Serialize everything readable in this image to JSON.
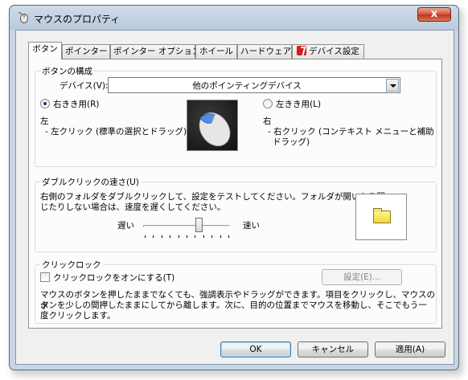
{
  "window": {
    "title": "マウスのプロパティ",
    "close_label": "x"
  },
  "tabs": [
    {
      "label": "ボタン"
    },
    {
      "label": "ポインター"
    },
    {
      "label": "ポインター オプション"
    },
    {
      "label": "ホイール"
    },
    {
      "label": "ハードウェア"
    },
    {
      "label": "デバイス設定"
    }
  ],
  "button_config": {
    "group_title": "ボタンの構成",
    "device_label": "デバイス(V):",
    "device_value": "他のポインティングデバイス",
    "right_handed_label": "右きき用(R)",
    "left_handed_label": "左きき用(L)",
    "left_title": "左",
    "left_desc": "- 左クリック (標準の選択とドラッグ)",
    "right_title": "右",
    "right_desc_line1": "- 右クリック (コンテキスト メニューと補助",
    "right_desc_line2": "ドラッグ)"
  },
  "double_click": {
    "group_title": "ダブルクリックの速さ(U)",
    "desc_line1": "右側のフォルダをダブルクリックして、設定をテストしてください。フォルダが開いたり閉",
    "desc_line2": "じたりしない場合は、速度を遅くしてください。",
    "slow_label": "遅い",
    "fast_label": "速い",
    "speed_fraction": 0.64
  },
  "click_lock": {
    "group_title": "クリックロック",
    "checkbox_label": "クリックロックをオンにする(T)",
    "settings_button": "設定(E)...",
    "desc_line1": "マウスのボタンを押したままでなくても、強調表示やドラッグができます。項目をクリックし、マウスのボ",
    "desc_line2": "タンを少しの間押したままにしてから離します。次に、目的の位置までマウスを移動し、そこでもう一",
    "desc_line3": "度クリックします。"
  },
  "buttons": {
    "ok": "OK",
    "cancel": "キャンセル",
    "apply": "適用(A)"
  },
  "colors": {
    "accent": "#3c7fb1",
    "tab_icon": "#d41b1b",
    "folder": "#f0d640"
  }
}
